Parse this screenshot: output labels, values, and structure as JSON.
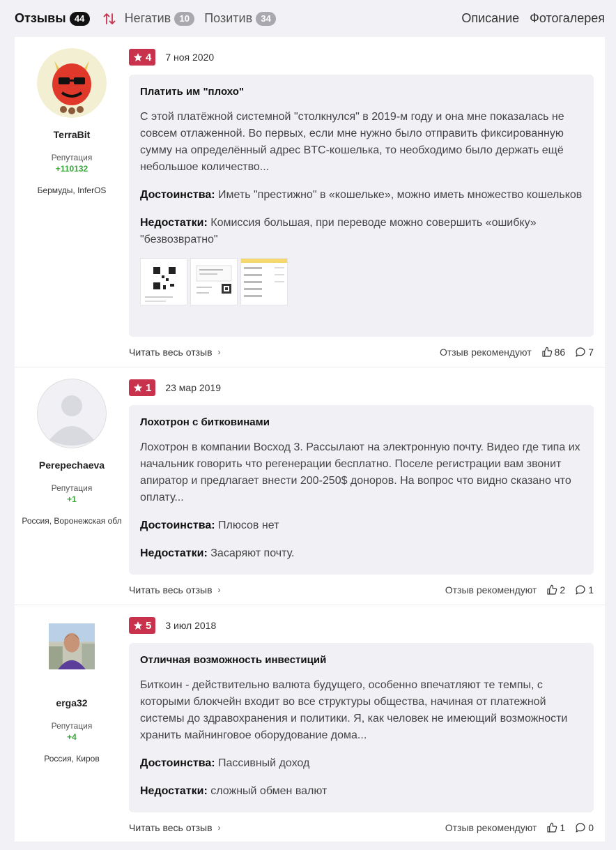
{
  "tabs": {
    "reviews": {
      "label": "Отзывы",
      "count": "44"
    },
    "negative": {
      "label": "Негатив",
      "count": "10"
    },
    "positive": {
      "label": "Позитив",
      "count": "34"
    },
    "description": "Описание",
    "gallery": "Фотогалерея"
  },
  "colors": {
    "rating": "#c8324d",
    "reputation": "#3aa43a",
    "card": "#f1f1f5"
  },
  "common": {
    "reputation_label": "Репутация",
    "pros_label": "Достоинства:",
    "cons_label": "Недостатки:",
    "read_more": "Читать весь отзыв",
    "recommend": "Отзыв рекомендуют"
  },
  "reviews": [
    {
      "username": "TerraBit",
      "reputation": "+110132",
      "location": "Бермуды, InferOS",
      "rating": "4",
      "date": "7 ноя 2020",
      "title": "Платить им \"плохо\"",
      "text": "С этой платёжной системной \"столкнулся\" в 2019-м году и она мне показалась не совсем отлаженной. Во первых, если мне нужно было отправить фиксированную сумму на определённый адрес BTC-кошелька, то необходимо было держать ещё небольшое количество...",
      "pros": "Иметь \"престижно\" в «кошельке», можно иметь множество кошельков",
      "cons": "Комиссия большая, при переводе можно совершить «ошибку» \"безвозвратно\"",
      "likes": "86",
      "comments": "7"
    },
    {
      "username": "Perepechaeva",
      "reputation": "+1",
      "location": "Россия, Воронежская обл",
      "rating": "1",
      "date": "23 мар 2019",
      "title": "Лохотрон с битковинами",
      "text": "Лохотрон в компании Восход 3. Рассылают на электронную почту. Видео где типа их начальник говорить что регенерации бесплатно. Поселе регистрации вам звонит апиратор и предлагает внести 200-250$ доноров. На вопрос что видно сказано что оплату...",
      "pros": "Плюсов нет",
      "cons": "Засаряют почту.",
      "likes": "2",
      "comments": "1"
    },
    {
      "username": "ergа32",
      "reputation": "+4",
      "location": "Россия, Киров",
      "rating": "5",
      "date": "3 июл 2018",
      "title": "Отличная возможность инвестиций",
      "text": "Биткоин - действительно валюта будущего, особенно впечатляют те темпы, с которыми блокчейн входит во все структуры общества, начиная от платежной системы до здравохранения и политики. Я, как человек не имеющий возможности хранить майнинговое оборудование дома...",
      "pros": "Пассивный доход",
      "cons": "сложный обмен валют",
      "likes": "1",
      "comments": "0"
    }
  ]
}
